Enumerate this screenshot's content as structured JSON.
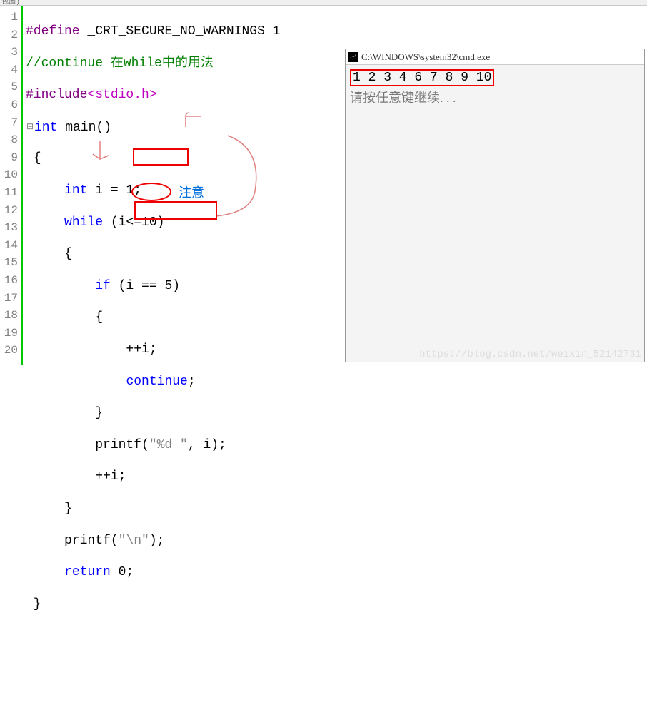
{
  "topBar": "包围)",
  "gutter": [
    "1",
    "2",
    "3",
    "4",
    "5",
    "6",
    "7",
    "8",
    "9",
    "10",
    "11",
    "12",
    "13",
    "14",
    "15",
    "16",
    "17",
    "18",
    "19",
    "20"
  ],
  "code": {
    "l1_a": "#define",
    "l1_b": " _CRT_SECURE_NO_WARNINGS ",
    "l1_c": "1",
    "l2": "//continue 在while中的用法",
    "l3_a": "#include",
    "l3_b": "<stdio.h>",
    "l4_a": "int",
    "l4_b": " main()",
    "l5": " {",
    "l6_a": "     ",
    "l6_b": "int",
    "l6_c": " i = ",
    "l6_d": "1",
    "l6_e": ";",
    "l7_a": "     ",
    "l7_b": "while",
    "l7_c": " (i<=",
    "l7_d": "10",
    "l7_e": ")",
    "l8": "     {",
    "l9_a": "         ",
    "l9_b": "if",
    "l9_c": " (i == ",
    "l9_d": "5",
    "l9_e": ")",
    "l10": "         {",
    "l11": "             ++i;",
    "l12_a": "             ",
    "l12_b": "continue",
    "l12_c": ";",
    "l13": "         }",
    "l14_a": "         printf(",
    "l14_b": "\"%d \"",
    "l14_c": ", i);",
    "l15": "         ++i;",
    "l16": "     }",
    "l17_a": "     printf(",
    "l17_b": "\"\\n\"",
    "l17_c": ");",
    "l18_a": "     ",
    "l18_b": "return",
    "l18_c": " ",
    "l18_d": "0",
    "l18_e": ";",
    "l19": " }"
  },
  "note": "注意",
  "console": {
    "title": "C:\\WINDOWS\\system32\\cmd.exe",
    "output": "1 2 3 4 6 7 8 9 10",
    "prompt": "请按任意键继续. . ."
  },
  "watermark": "https://blog.csdn.net/weixin_52142731"
}
